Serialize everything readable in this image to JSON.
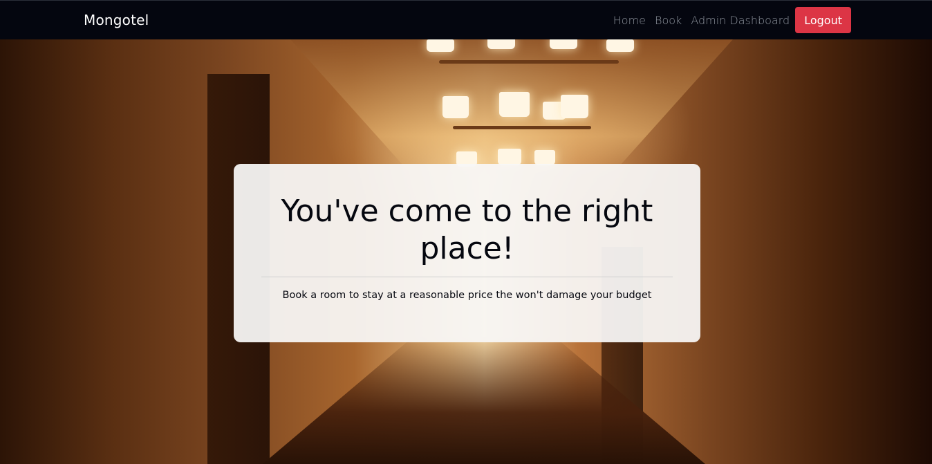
{
  "navbar": {
    "brand": "Mongotel",
    "links": [
      "Home",
      "Book",
      "Admin Dashboard"
    ],
    "logout_label": "Logout",
    "colors": {
      "background": "#04060f",
      "logout": "#dc3545"
    }
  },
  "hero": {
    "title": "You've come to the right place!",
    "subtitle": "Book a room to stay at a reasonable price the won't damage your budget"
  }
}
